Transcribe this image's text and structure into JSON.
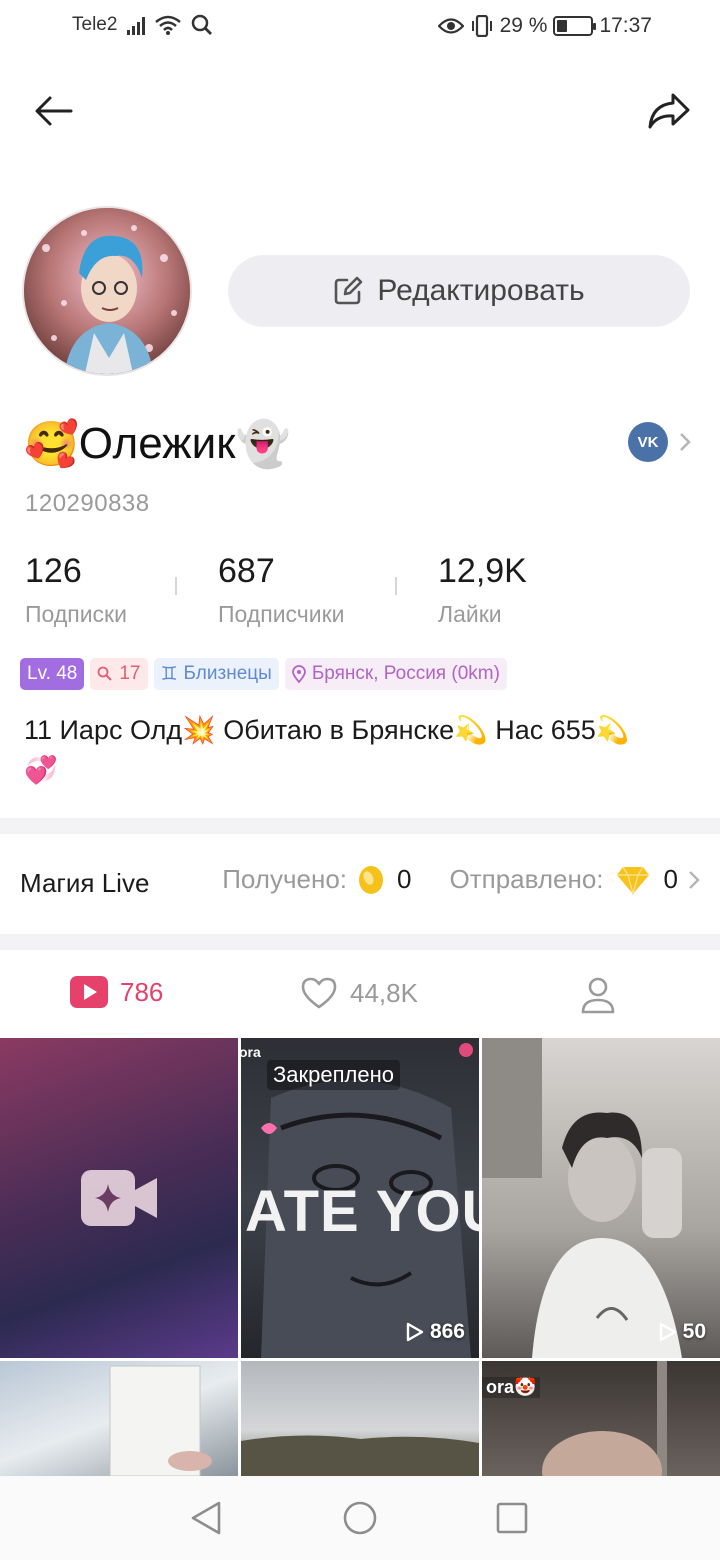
{
  "status_bar": {
    "carrier": "Tele2",
    "battery_percent": "29 %",
    "battery_level": 0.29,
    "time": "17:37",
    "icons": [
      "signal-icon",
      "wifi-icon",
      "search-icon",
      "eye-icon",
      "vibrate-icon",
      "battery-icon"
    ]
  },
  "nav": {
    "back_icon": "arrow-left-icon",
    "share_icon": "share-icon"
  },
  "profile": {
    "edit_label": "Редактировать",
    "edit_icon": "edit-icon",
    "name_emoji_left": "🥰",
    "name": "Олежик",
    "name_emoji_right": "👻",
    "user_id": "120290838",
    "vk_label": "VK"
  },
  "stats": [
    {
      "value": "126",
      "label": "Подписки"
    },
    {
      "value": "687",
      "label": "Подписчики"
    },
    {
      "value": "12,9K",
      "label": "Лайки"
    }
  ],
  "tags": {
    "level": "Lv. 48",
    "follow_count": "17",
    "zodiac": "Близнецы",
    "zodiac_symbol": "♊",
    "location": "Брянск, Россия (0km)"
  },
  "bio": {
    "line1": "11 Иарс Олд💥  Обитаю в Брянске💫  Нас 655💫",
    "line2": "💞"
  },
  "magic": {
    "title": "Магия Live",
    "received_label": "Получено:",
    "received_value": "0",
    "sent_label": "Отправлено:",
    "sent_value": "0"
  },
  "tabs": {
    "videos_count": "786",
    "likes_count": "44,8K"
  },
  "grid": {
    "pinned_label": "Закреплено",
    "overlay_text": "ATE YOU",
    "video2_views": "866",
    "video3_views": "50",
    "tag_text_1": "ora",
    "tag_text_2": "ora🤡"
  },
  "colors": {
    "accent": "#e5416b",
    "level_bg": "#a36de2",
    "vk": "#4a72a8"
  }
}
